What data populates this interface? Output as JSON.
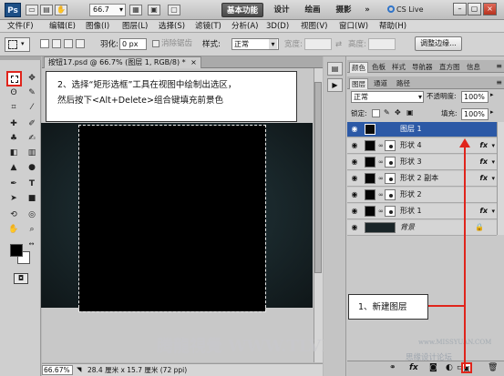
{
  "appbar": {
    "logo": "Ps",
    "zoom": "66.7",
    "workspaces": [
      "基本功能",
      "设计",
      "绘画",
      "摄影",
      "»"
    ],
    "cslive": "CS Live",
    "window_buttons": [
      "minimize-icon",
      "restore-icon",
      "close-icon"
    ]
  },
  "menu": [
    "文件(F)",
    "编辑(E)",
    "图像(I)",
    "图层(L)",
    "选择(S)",
    "滤镜(T)",
    "分析(A)",
    "3D(D)",
    "视图(V)",
    "窗口(W)",
    "帮助(H)"
  ],
  "options": {
    "feather_label": "羽化:",
    "feather_value": "0 px",
    "antialias_label": "消除锯齿",
    "style_label": "样式:",
    "style_value": "正常",
    "width_label": "宽度:",
    "height_label": "高度:",
    "refine_button": "调整边缘..."
  },
  "document": {
    "tab_title": "按钮17.psd @ 66.7% (图层 1, RGB/8) *",
    "tab_close": "×",
    "status_zoom": "66.67%",
    "status_info": "28.4 厘米 x 15.7 厘米 (72 ppi)"
  },
  "callouts": {
    "step2_line1": "2、选择“矩形选框”工具在视图中绘制出选区，",
    "step2_line2": "然后按下<Alt+Delete>组合键填充前景色",
    "step1": "1、新建图层"
  },
  "panels": {
    "top_tabs": [
      "颜色",
      "色板",
      "样式",
      "导航器",
      "直方图",
      "信息"
    ],
    "layer_tabs": [
      "图层",
      "通道",
      "路径"
    ],
    "blend_mode": "正常",
    "opacity_label": "不透明度:",
    "opacity_value": "100%",
    "lock_label": "锁定:",
    "fill_label": "填充:",
    "fill_value": "100%",
    "layers": [
      {
        "name": "图层 1",
        "selected": true,
        "fx": "",
        "mask": false,
        "locked": false
      },
      {
        "name": "形状 4",
        "selected": false,
        "fx": "fx",
        "mask": true,
        "locked": false
      },
      {
        "name": "形状 3",
        "selected": false,
        "fx": "fx",
        "mask": true,
        "locked": false
      },
      {
        "name": "形状 2 副本",
        "selected": false,
        "fx": "fx",
        "mask": true,
        "locked": false
      },
      {
        "name": "形状 2",
        "selected": false,
        "fx": "",
        "mask": true,
        "locked": false
      },
      {
        "name": "形状 1",
        "selected": false,
        "fx": "fx",
        "mask": true,
        "locked": false
      },
      {
        "name": "背景",
        "selected": false,
        "fx": "",
        "mask": false,
        "locked": true
      }
    ]
  },
  "watermarks": {
    "main": "腾龍視覺 WWW.TLVI.NET",
    "forum": "思缘设计论坛",
    "forum_url": "www.MISSYUAN.COM"
  },
  "colors": {
    "accent_red": "#e0241b",
    "layer_selected": "#2c59a6",
    "foreground": "#000000",
    "background": "#ffffff"
  }
}
